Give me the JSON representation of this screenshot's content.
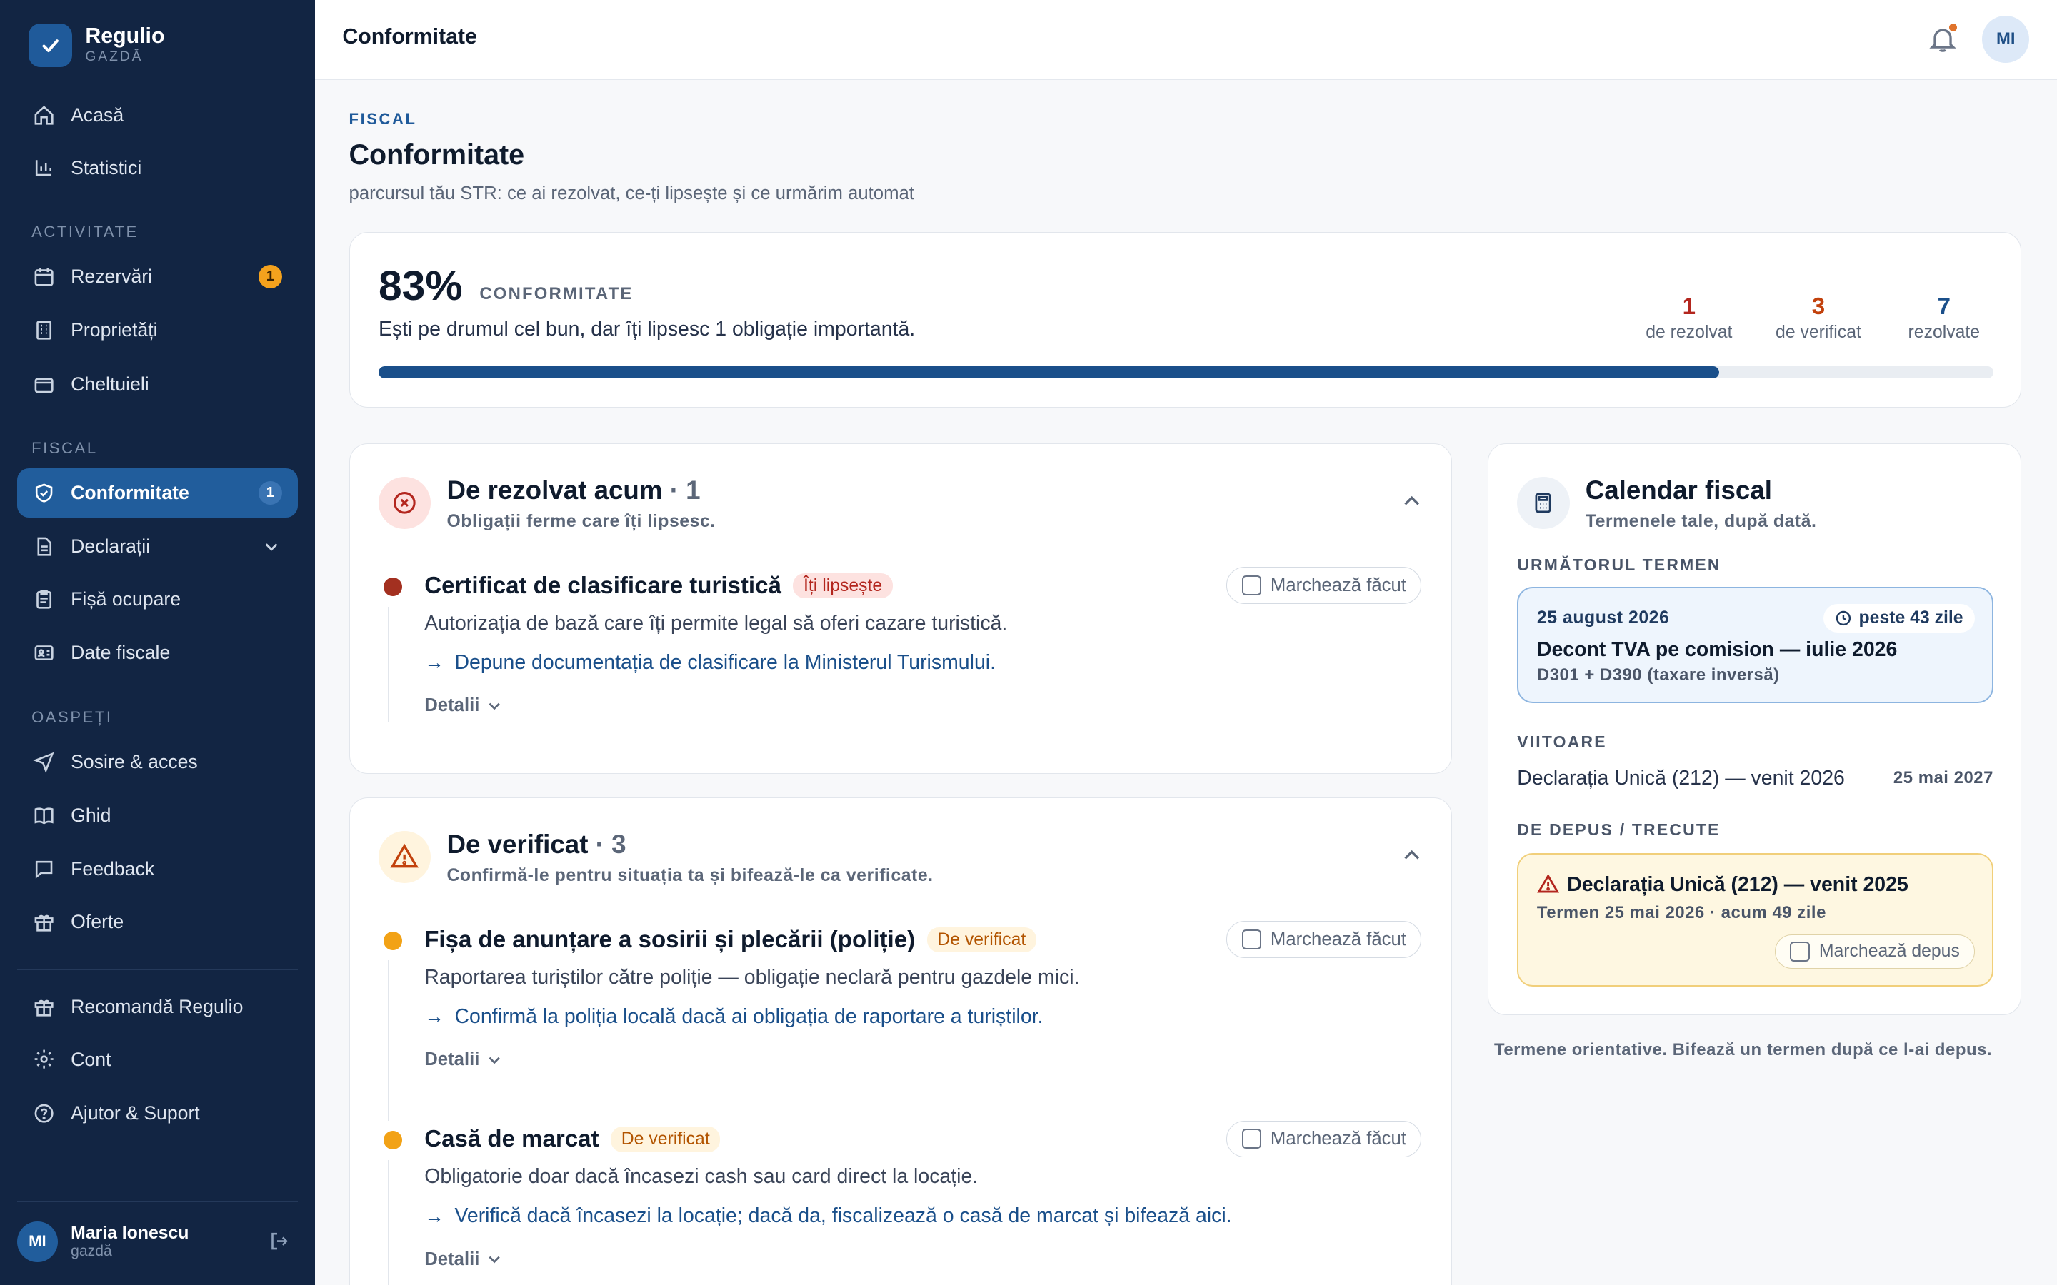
{
  "brand": {
    "name": "Regulio",
    "sub": "GAZDĂ"
  },
  "sidebar": {
    "items_top": [
      {
        "label": "Acasă",
        "icon": "home-icon"
      },
      {
        "label": "Statistici",
        "icon": "chart-icon"
      }
    ],
    "sections": [
      "ACTIVITATE",
      "FISCAL",
      "OASPEȚI"
    ],
    "activity": [
      {
        "label": "Rezervări",
        "badge": "1"
      },
      {
        "label": "Proprietăți"
      },
      {
        "label": "Cheltuieli"
      }
    ],
    "fiscal": [
      {
        "label": "Conformitate",
        "badge": "1"
      },
      {
        "label": "Declarații"
      },
      {
        "label": "Fișă ocupare"
      },
      {
        "label": "Date fiscale"
      }
    ],
    "guests": [
      {
        "label": "Sosire & acces"
      },
      {
        "label": "Ghid"
      },
      {
        "label": "Feedback"
      },
      {
        "label": "Oferte"
      }
    ],
    "bottom": [
      {
        "label": "Recomandă Regulio"
      },
      {
        "label": "Cont"
      },
      {
        "label": "Ajutor & Suport"
      }
    ],
    "user": {
      "initials": "MI",
      "name": "Maria Ionescu",
      "role": "gazdă"
    }
  },
  "topbar": {
    "title": "Conformitate",
    "avatar": "MI"
  },
  "page": {
    "eyebrow": "FISCAL",
    "title": "Conformitate",
    "subtitle": "parcursul tău STR: ce ai rezolvat, ce-ți lipsește și ce urmărim automat"
  },
  "score": {
    "percent": "83%",
    "label": "CONFORMITATE",
    "message": "Ești pe drumul cel bun, dar îți lipsesc 1 obligație importantă.",
    "progress": 0.83,
    "stats": [
      {
        "num": "1",
        "label": "de rezolvat",
        "color": "#b3261e"
      },
      {
        "num": "3",
        "label": "de verificat",
        "color": "#c2410c"
      },
      {
        "num": "7",
        "label": "rezolvate",
        "color": "#1a4f8a"
      }
    ]
  },
  "resolve": {
    "title": "De rezolvat acum",
    "count": "· 1",
    "subtitle": "Obligații ferme care îți lipsesc.",
    "items": [
      {
        "title": "Certificat de clasificare turistică",
        "tag": "Îți lipsește",
        "desc": "Autorizația de bază care îți permite legal să oferi cazare turistică.",
        "action": "Depune documentația de clasificare la Ministerul Turismului.",
        "details": "Detalii",
        "mark": "Marchează făcut"
      }
    ]
  },
  "verify": {
    "title": "De verificat",
    "count": "· 3",
    "subtitle": "Confirmă-le pentru situația ta și bifează-le ca verificate.",
    "items": [
      {
        "title": "Fișa de anunțare a sosirii și plecării (poliție)",
        "tag": "De verificat",
        "desc": "Raportarea turiștilor către poliție — obligație neclară pentru gazdele mici.",
        "action": "Confirmă la poliția locală dacă ai obligația de raportare a turiștilor.",
        "details": "Detalii",
        "mark": "Marchează făcut"
      },
      {
        "title": "Casă de marcat",
        "tag": "De verificat",
        "desc": "Obligatorie doar dacă încasezi cash sau card direct la locație.",
        "action": "Verifică dacă încasezi la locație; dacă da, fiscalizează o casă de marcat și bifează aici.",
        "details": "Detalii",
        "mark": "Marchează făcut"
      }
    ]
  },
  "calendar": {
    "title": "Calendar fiscal",
    "subtitle": "Termenele tale, după dată.",
    "next_label": "URMĂTORUL TERMEN",
    "next": {
      "date": "25 august 2026",
      "in": "peste 43 zile",
      "title": "Decont TVA pe comision — iulie 2026",
      "sub": "D301 + D390 (taxare inversă)"
    },
    "future_label": "VIITOARE",
    "future": {
      "name": "Declarația Unică (212) — venit 2026",
      "date": "25 mai 2027"
    },
    "past_label": "DE DEPUS / TRECUTE",
    "past": {
      "title": "Declarația Unică (212) — venit 2025",
      "sub": "Termen 25 mai 2026 · acum 49 zile",
      "button": "Marchează depus"
    },
    "note": "Termene orientative. Bifează un termen după ce l-ai depus."
  }
}
